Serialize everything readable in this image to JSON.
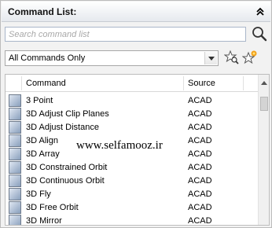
{
  "panel": {
    "title": "Command List:",
    "search_placeholder": "Search command list",
    "search_value": "",
    "filter_selected": "All Commands Only"
  },
  "list": {
    "columns": [
      "Command",
      "Source"
    ],
    "rows": [
      {
        "command": "3 Point",
        "source": "ACAD"
      },
      {
        "command": "3D Adjust Clip Planes",
        "source": "ACAD"
      },
      {
        "command": "3D Adjust Distance",
        "source": "ACAD"
      },
      {
        "command": "3D Align",
        "source": "ACAD"
      },
      {
        "command": "3D Array",
        "source": "ACAD"
      },
      {
        "command": "3D Constrained Orbit",
        "source": "ACAD"
      },
      {
        "command": "3D Continuous Orbit",
        "source": "ACAD"
      },
      {
        "command": "3D Fly",
        "source": "ACAD"
      },
      {
        "command": "3D Free Orbit",
        "source": "ACAD"
      },
      {
        "command": "3D Mirror",
        "source": "ACAD"
      }
    ]
  },
  "watermark": "www.selfamooz.ir"
}
